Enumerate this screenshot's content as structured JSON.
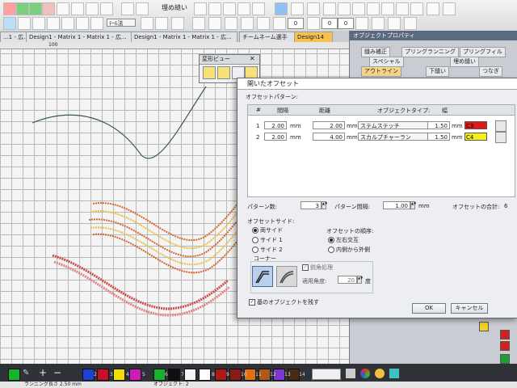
{
  "toolbar": {
    "sel_label": "ﾃｰﾙ法",
    "fill_label": "埋め縫い",
    "num1": "0",
    "num2": "0",
    "num3": "0"
  },
  "tabs": [
    {
      "label": "...1 - 広..."
    },
    {
      "label": "Design1 - Matrix 1 - Matrix 1 - 広..."
    },
    {
      "label": "Design1 - Matrix 1 - Matrix 1 - 広..."
    },
    {
      "label": "チームネーム選手"
    },
    {
      "label": "Design14"
    }
  ],
  "ruler": {
    "mark": "100"
  },
  "transform_view": {
    "title": "変形ビュー"
  },
  "right_panel": {
    "title": "オブジェクトプロパティ",
    "tabs": [
      "縫み補正",
      "プリングランニング",
      "プリングフィル",
      "スペシャル",
      "埋め縫い",
      "アウトライン",
      "下縫い",
      "つなぎ"
    ]
  },
  "dialog": {
    "title": "開いたオフセット",
    "section_pattern": "オフセットパターン:",
    "col_num": "#",
    "col_spacing": "間隔",
    "col_distance": "距離",
    "col_type": "オブジェクトタイプ:",
    "col_width": "幅",
    "rows": [
      {
        "num": "1",
        "spacing": "2.00",
        "distance": "2.00",
        "type": "ステムステッチ",
        "width": "1.50",
        "color_label": "C3",
        "color": "#e01818"
      },
      {
        "num": "2",
        "spacing": "2.00",
        "distance": "4.00",
        "type": "スカルプチャーラン",
        "width": "1.50",
        "color_label": "C4",
        "color": "#f4f01a"
      }
    ],
    "unit": "mm",
    "pattern_count_label": "パターン数:",
    "pattern_count": "3",
    "pattern_spacing_label": "パターン間隔:",
    "pattern_spacing": "1.00",
    "offset_total_label": "オフセットの合計:",
    "offset_total": "6",
    "side_label": "オフセットサイド:",
    "side_both": "両サイド",
    "side_1": "サイド 1",
    "side_2": "サイド 2",
    "order_label": "オフセットの順序:",
    "order_alt": "左右交互",
    "order_inout": "内側から外側",
    "corner_label": "コーナー",
    "sharp_label": "鋭角処理",
    "angle_label": "適用角度:",
    "angle": "20",
    "angle_unit": "度",
    "keep_original": "基のオブジェクトを残す",
    "ok": "OK",
    "cancel": "キャンセル"
  },
  "palette": {
    "colors": [
      "#18b32a",
      "#1a1a1a",
      "#ffffff",
      "#1e3fd8",
      "#c8102e",
      "#f0e000",
      "#d01ab8",
      "#18b030",
      "#101010",
      "#f5f5f5",
      "#b01818",
      "#8a1a1a",
      "#e07010",
      "#b05818",
      "#7a3ad0",
      "#4a2a10"
    ],
    "numbers": [
      "2",
      "3",
      "4",
      "5",
      "6",
      "7",
      "8",
      "9",
      "10",
      "11",
      "12",
      "13",
      "14"
    ]
  },
  "status": {
    "left": "ランニング長さ 2.50 mm",
    "mid": "オブジェクト: 2"
  }
}
